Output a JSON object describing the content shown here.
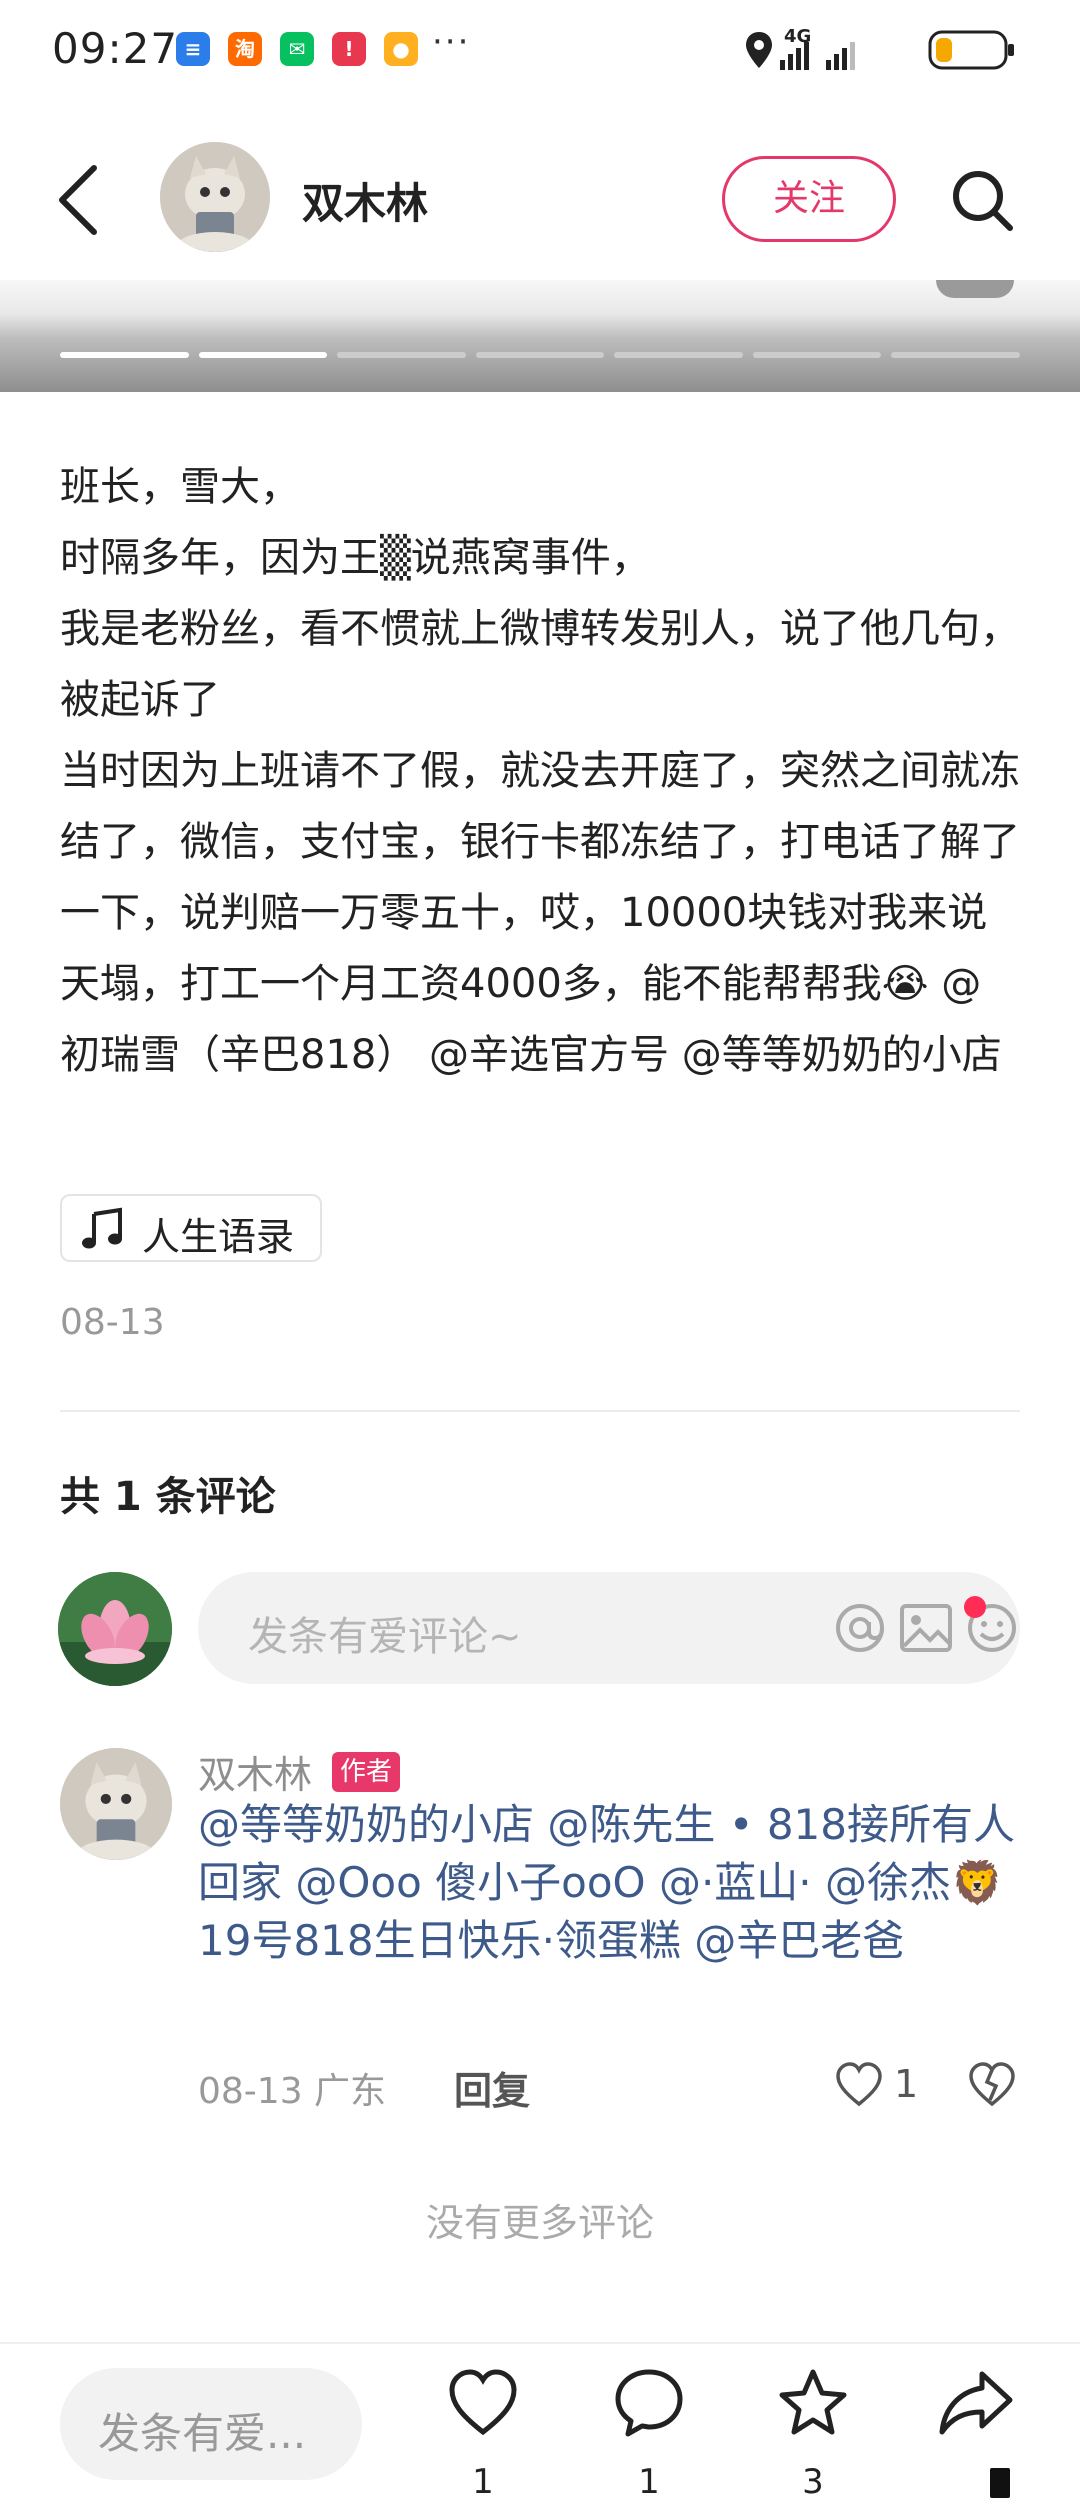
{
  "status_bar": {
    "time": "09:27",
    "app_icons": [
      {
        "name": "message-app-icon",
        "glyph": "≡",
        "color": "#2b7de9"
      },
      {
        "name": "taobao-icon",
        "glyph": "淘",
        "color": "#ff6a00"
      },
      {
        "name": "wechat-icon",
        "glyph": "✉",
        "color": "#07c160"
      },
      {
        "name": "notification-icon",
        "glyph": "!",
        "color": "#e8384f"
      },
      {
        "name": "game-icon",
        "glyph": "●",
        "color": "#ff9f1a"
      }
    ],
    "more": "···",
    "network": "4G",
    "battery_level": 0.25
  },
  "header": {
    "author_name": "双木林",
    "follow_label": "关注"
  },
  "image_strip": {
    "page_count": 7,
    "active_pages": [
      0,
      1
    ]
  },
  "post": {
    "text": "班长，雪大，\n时隔多年，因为王▒说燕窝事件，\n我是老粉丝，看不惯就上微博转发别人，说了他几句，被起诉了\n当时因为上班请不了假，就没去开庭了，突然之间就冻结了，微信，支付宝，银行卡都冻结了，打电话了解了一下，说判赔一万零五十，哎，10000块钱对我来说天塌，打工一个月工资4000多，能不能帮帮我😭 @初瑞雪（辛巴818） @辛选官方号 @等等奶奶的小店",
    "music_tag": "人生语录",
    "date": "08-13"
  },
  "comments": {
    "count_label": "共 1 条评论",
    "input_placeholder": "发条有爱评论~",
    "items": [
      {
        "author": "双木林",
        "badge": "作者",
        "text": "@等等奶奶的小店 @陈先生 • 818接所有人回家 @Ooo 傻小子ooO @·蓝山· @徐杰🦁19号818生日快乐·领蛋糕 @辛巴老爸",
        "meta": "08-13 广东",
        "reply_label": "回复",
        "likes": "1"
      }
    ],
    "no_more": "没有更多评论"
  },
  "bottom_bar": {
    "input_placeholder": "发条有爱...",
    "like_count": "1",
    "comment_count": "1",
    "collect_count": "3"
  },
  "colors": {
    "accent": "#e5386a",
    "mention": "#3d5a8a"
  }
}
